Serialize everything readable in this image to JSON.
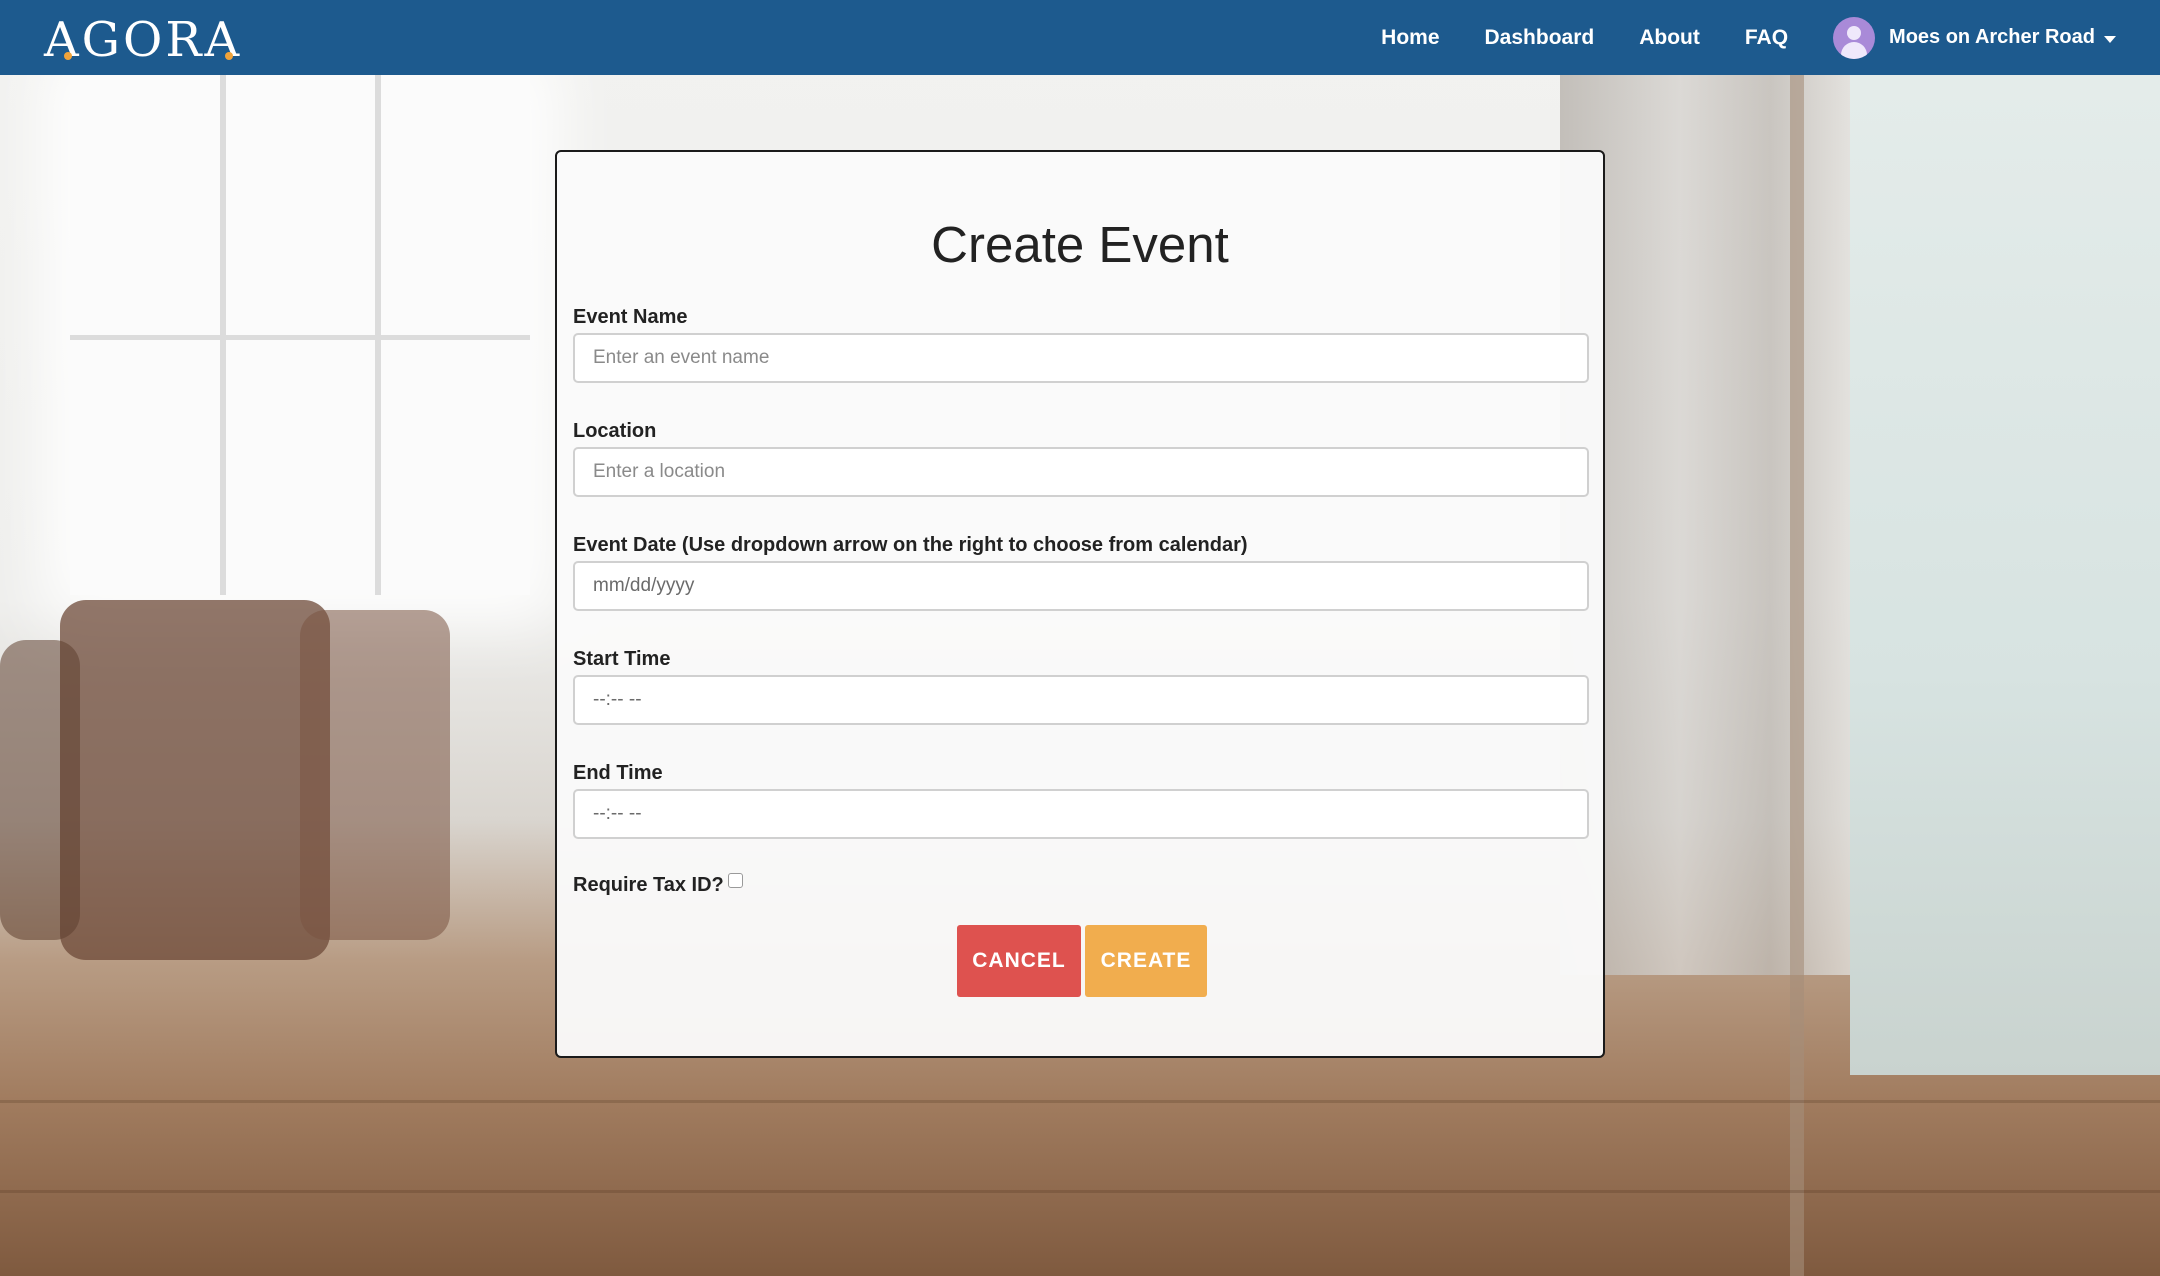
{
  "colors": {
    "navbar": "#1d5a8e",
    "cancel_button": "#de524f",
    "create_button": "#f1ad4e",
    "logo_accent": "#f0a33a",
    "avatar": "#a98ad8"
  },
  "navbar": {
    "logo": "AGORA",
    "links": [
      "Home",
      "Dashboard",
      "About",
      "FAQ"
    ],
    "user": {
      "name": "Moes on Archer Road",
      "avatar_icon": "user-avatar-icon",
      "dropdown_icon": "caret-down-icon"
    }
  },
  "form": {
    "title": "Create Event",
    "fields": [
      {
        "label": "Event Name",
        "placeholder": "Enter an event name",
        "value": ""
      },
      {
        "label": "Location",
        "placeholder": "Enter a location",
        "value": ""
      },
      {
        "label": "Event Date (Use dropdown arrow on the right to choose from calendar)",
        "placeholder": "",
        "value": "mm/dd/yyyy"
      },
      {
        "label": "Start Time",
        "placeholder": "",
        "value": "--:-- --"
      },
      {
        "label": "End Time",
        "placeholder": "",
        "value": "--:-- --"
      }
    ],
    "checkbox": {
      "label": "Require Tax ID?",
      "checked": false
    },
    "buttons": {
      "cancel": "CANCEL",
      "create": "CREATE"
    }
  }
}
